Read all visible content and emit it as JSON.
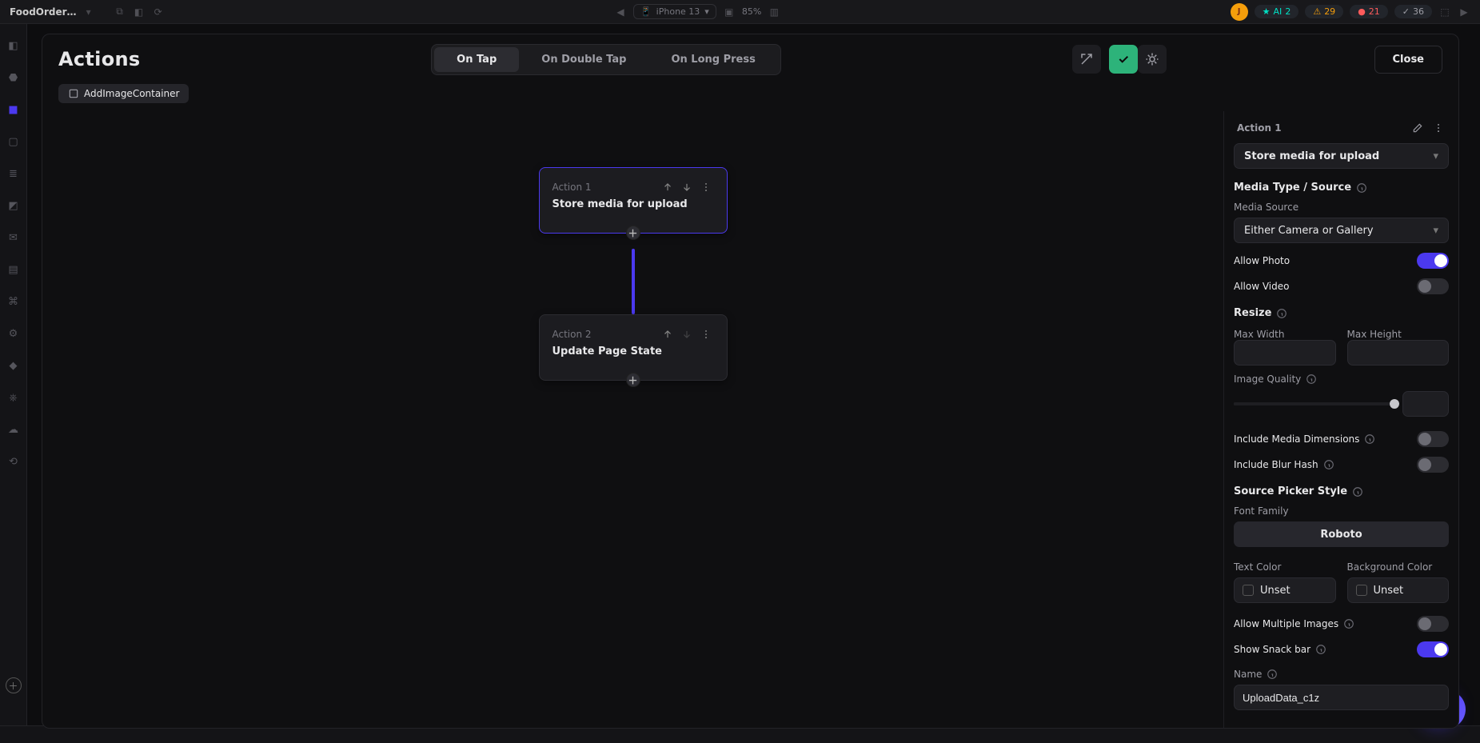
{
  "app_bar": {
    "project": "FoodOrder…",
    "device": "iPhone 13",
    "zoom": "85%",
    "avatar": "J",
    "ai_label": "AI",
    "ai_count": "2",
    "warn_count": "29",
    "err_count": "21",
    "ok_count": "36"
  },
  "dialog": {
    "title": "Actions",
    "tabs": {
      "on_tap": "On Tap",
      "on_double": "On Double Tap",
      "on_long": "On Long Press"
    },
    "close": "Close",
    "breadcrumb": "AddImageContainer"
  },
  "canvas": {
    "action1_label": "Action 1",
    "action1_title": "Store media for upload",
    "action2_label": "Action 2",
    "action2_title": "Update Page State"
  },
  "panel": {
    "header": "Action 1",
    "action_type": "Store media for upload",
    "media_section": "Media Type / Source",
    "media_source_label": "Media Source",
    "media_source_value": "Either Camera or Gallery",
    "allow_photo": "Allow Photo",
    "allow_video": "Allow Video",
    "resize_section": "Resize",
    "max_width": "Max Width",
    "max_width_value": "",
    "max_height": "Max Height",
    "max_height_value": "",
    "image_quality": "Image Quality",
    "image_quality_value": "",
    "include_dimensions": "Include Media Dimensions",
    "include_blur": "Include Blur Hash",
    "source_picker": "Source Picker Style",
    "font_family_label": "Font Family",
    "font_family_value": "Roboto",
    "text_color_label": "Text Color",
    "text_color_value": "Unset",
    "bg_color_label": "Background Color",
    "bg_color_value": "Unset",
    "allow_multiple": "Allow Multiple Images",
    "show_snackbar": "Show Snack bar",
    "name_label": "Name",
    "name_value": "UploadData_c1z"
  }
}
